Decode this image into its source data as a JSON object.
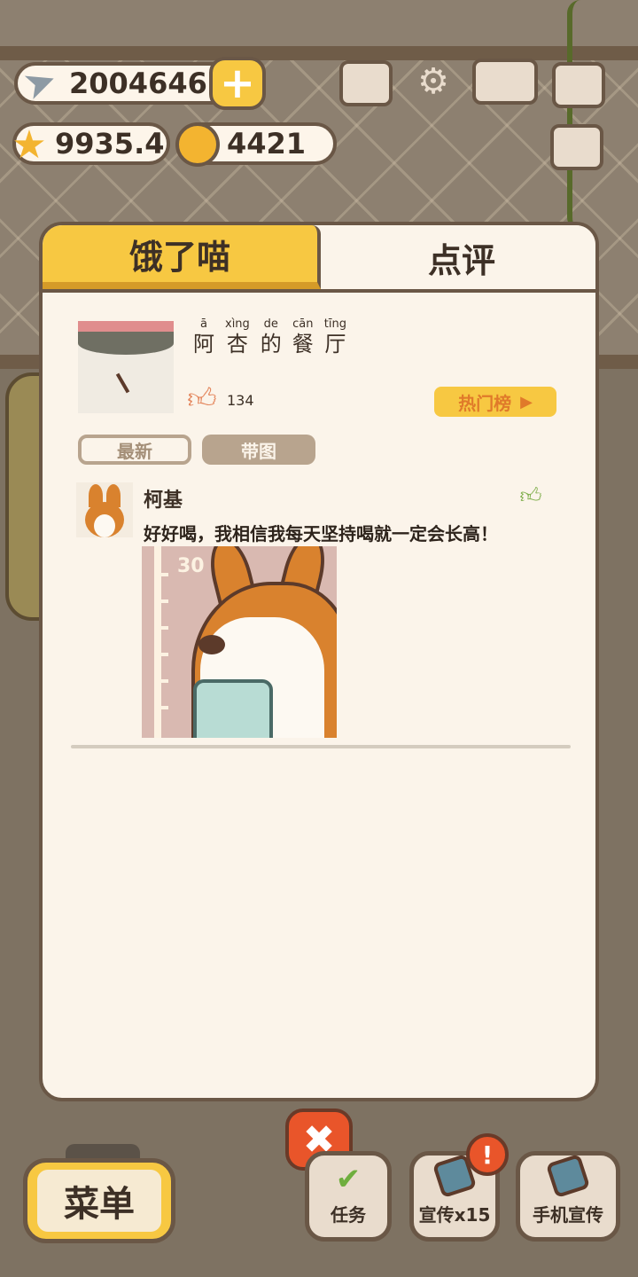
{
  "hud": {
    "fish": "2004646",
    "stars": "9935.4",
    "bells": "4421",
    "plus_label": "+"
  },
  "icons": {
    "fish": "fish-icon",
    "star": "star-icon",
    "bell": "bell-icon",
    "rank": "rank-podium-icon",
    "settings": "gear-icon",
    "book": "recipe-book-icon",
    "camera": "camera-icon",
    "card": "card-icon"
  },
  "panel": {
    "tabs": [
      {
        "label": "饿了喵",
        "active": false
      },
      {
        "label": "点评",
        "active": true
      }
    ],
    "restaurant": {
      "name_chars": [
        {
          "pinyin": "ā",
          "char": "阿"
        },
        {
          "pinyin": "xìng",
          "char": "杏"
        },
        {
          "pinyin": "de",
          "char": "的"
        },
        {
          "pinyin": "cān",
          "char": "餐"
        },
        {
          "pinyin": "tīng",
          "char": "厅"
        }
      ],
      "likes": "134",
      "hot_button": "热门榜"
    },
    "filters": [
      {
        "label": "最新",
        "selected": false
      },
      {
        "label": "带图",
        "selected": true
      }
    ],
    "reviews": [
      {
        "name": "柯基",
        "text": "好好喝，我相信我每天坚持喝就一定会长高！",
        "photo_ruler_label": "30"
      }
    ]
  },
  "bottom": {
    "menu": "菜单",
    "task": "任务",
    "promo": "宣传x15",
    "phone_promo": "手机宣传",
    "alert": "!"
  },
  "colors": {
    "accent_yellow": "#f7c842",
    "panel_bg": "#fbf4ea",
    "border_brown": "#6a5746",
    "close_red": "#e9552a"
  }
}
